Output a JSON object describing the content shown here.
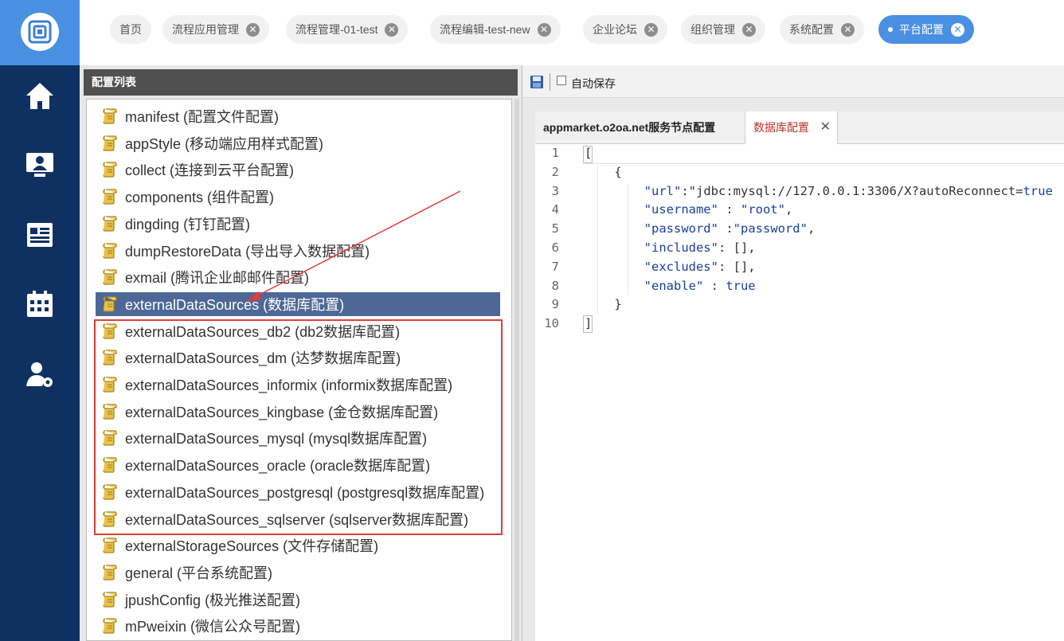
{
  "nav": {
    "logo_icon": "o2oa-logo-icon",
    "items": [
      "home-icon",
      "desktop-user-icon",
      "news-icon",
      "calendar-icon",
      "user-settings-icon"
    ]
  },
  "tabs": [
    {
      "label": "首页",
      "closable": false
    },
    {
      "label": "流程应用管理",
      "closable": true
    },
    {
      "label": "流程管理-01-test",
      "closable": true
    },
    {
      "label": "流程编辑-test-new",
      "closable": true
    },
    {
      "label": "企业论坛",
      "closable": true
    },
    {
      "label": "组织管理",
      "closable": true
    },
    {
      "label": "系统配置",
      "closable": true
    },
    {
      "label": "平台配置",
      "closable": true,
      "active": true
    }
  ],
  "tab_close_glyph": "✕",
  "config_panel": {
    "title": "配置列表",
    "items": [
      "manifest (配置文件配置)",
      "appStyle (移动端应用样式配置)",
      "collect (连接到云平台配置)",
      "components (组件配置)",
      "dingding (钉钉配置)",
      "dumpRestoreData (导出导入数据配置)",
      "exmail (腾讯企业邮邮件配置)",
      "externalDataSources (数据库配置)",
      "externalDataSources_db2 (db2数据库配置)",
      "externalDataSources_dm (达梦数据库配置)",
      "externalDataSources_informix (informix数据库配置)",
      "externalDataSources_kingbase (金仓数据库配置)",
      "externalDataSources_mysql (mysql数据库配置)",
      "externalDataSources_oracle (oracle数据库配置)",
      "externalDataSources_postgresql (postgresql数据库配置)",
      "externalDataSources_sqlserver (sqlserver数据库配置)",
      "externalStorageSources (文件存储配置)",
      "general (平台系统配置)",
      "jpushConfig (极光推送配置)",
      "mPweixin (微信公众号配置)"
    ],
    "selected_index": 7,
    "item_icon": "scroll-icon"
  },
  "toolbar": {
    "save_icon": "save-icon",
    "autosave_label": "自动保存",
    "autosave_checked": false
  },
  "editor": {
    "tabs": [
      {
        "label": "appmarket.o2oa.net服务节点配置"
      },
      {
        "label": "数据库配置",
        "active": true,
        "close": "✕"
      }
    ],
    "line_numbers": [
      "1",
      "2",
      "3",
      "4",
      "5",
      "6",
      "7",
      "8",
      "9",
      "10"
    ],
    "lines": [
      "[",
      "    {",
      "        \"url\":\"jdbc:mysql://127.0.0.1:3306/X?autoReconnect=true",
      "        \"username\" : \"root\",",
      "        \"password\" :\"password\",",
      "        \"includes\": [],",
      "        \"excludes\": [],",
      "        \"enable\" : true",
      "    }",
      "]"
    ]
  },
  "colors": {
    "sidebar": "#0f3162",
    "accent": "#4a90e2",
    "selected_item": "#4d6897",
    "highlight_border": "#e03c3c",
    "annotation_arrow": "#e03c3c"
  }
}
